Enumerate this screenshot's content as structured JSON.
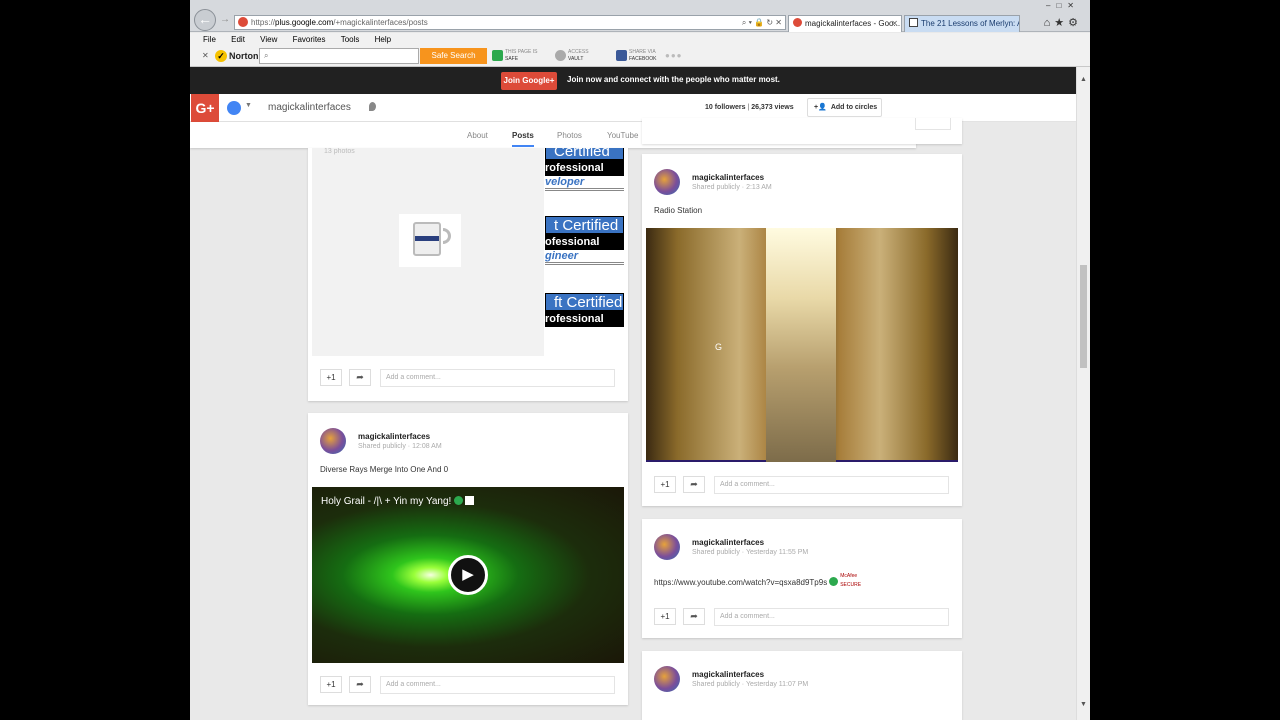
{
  "browser": {
    "address_prefix": "https://",
    "address_domain": "plus.google.com",
    "address_path": "/+magickalinterfaces/posts",
    "tabs": [
      {
        "label": "magickalinterfaces - Goo..."
      },
      {
        "label": "The 21 Lessons of Merlyn: A ..."
      }
    ],
    "menu": [
      "File",
      "Edit",
      "View",
      "Favorites",
      "Tools",
      "Help"
    ]
  },
  "norton": {
    "brand": "Norton",
    "search_button": "Safe Search",
    "badge1_top": "THIS PAGE IS",
    "badge1_bottom": "SAFE",
    "badge2_top": "ACCESS",
    "badge2_bottom": "VAULT",
    "badge3_top": "SHARE VIA",
    "badge3_bottom": "FACEBOOK"
  },
  "joinbar": {
    "button": "Join Google+",
    "text": "Join now and connect with the people who matter most."
  },
  "header": {
    "logo": "G+",
    "name": "magickalinterfaces",
    "followers": "10 followers",
    "separator": "|",
    "views": "26,373 views",
    "add_button": "Add to circles"
  },
  "tabs": [
    {
      "label": "About"
    },
    {
      "label": "Posts"
    },
    {
      "label": "Photos"
    },
    {
      "label": "YouTube"
    }
  ],
  "album": {
    "count": "13 photos",
    "certs": [
      {
        "top": "Certified",
        "mid": "rofessional",
        "bottom": "veloper"
      },
      {
        "top": "t Certified",
        "mid": "ofessional",
        "bottom": "gineer"
      },
      {
        "top": "ft Certified",
        "mid": "rofessional",
        "bottom": ""
      }
    ]
  },
  "posts": [
    {
      "author": "magickalinterfaces",
      "meta": "Shared publicly  ·  12:08 AM",
      "text": "Diverse Rays Merge Into One And 0",
      "video_title": "Holy Grail - /|\\ + Yin my Yang!"
    },
    {
      "author": "magickalinterfaces",
      "meta": "Shared publicly  ·  2:13 AM",
      "text": "Radio Station",
      "image_letter": "G"
    },
    {
      "author": "magickalinterfaces",
      "meta": "Shared publicly  ·  Yesterday 11:55 PM",
      "text": "https://www.youtube.com/watch?v=qsxa8d9Tp9s",
      "badge": "McAfee SECURE"
    },
    {
      "author": "magickalinterfaces",
      "meta": "Shared publicly  ·  Yesterday 11:07 PM"
    }
  ],
  "actions": {
    "plus_one": "+1",
    "comment_placeholder": "Add a comment..."
  }
}
